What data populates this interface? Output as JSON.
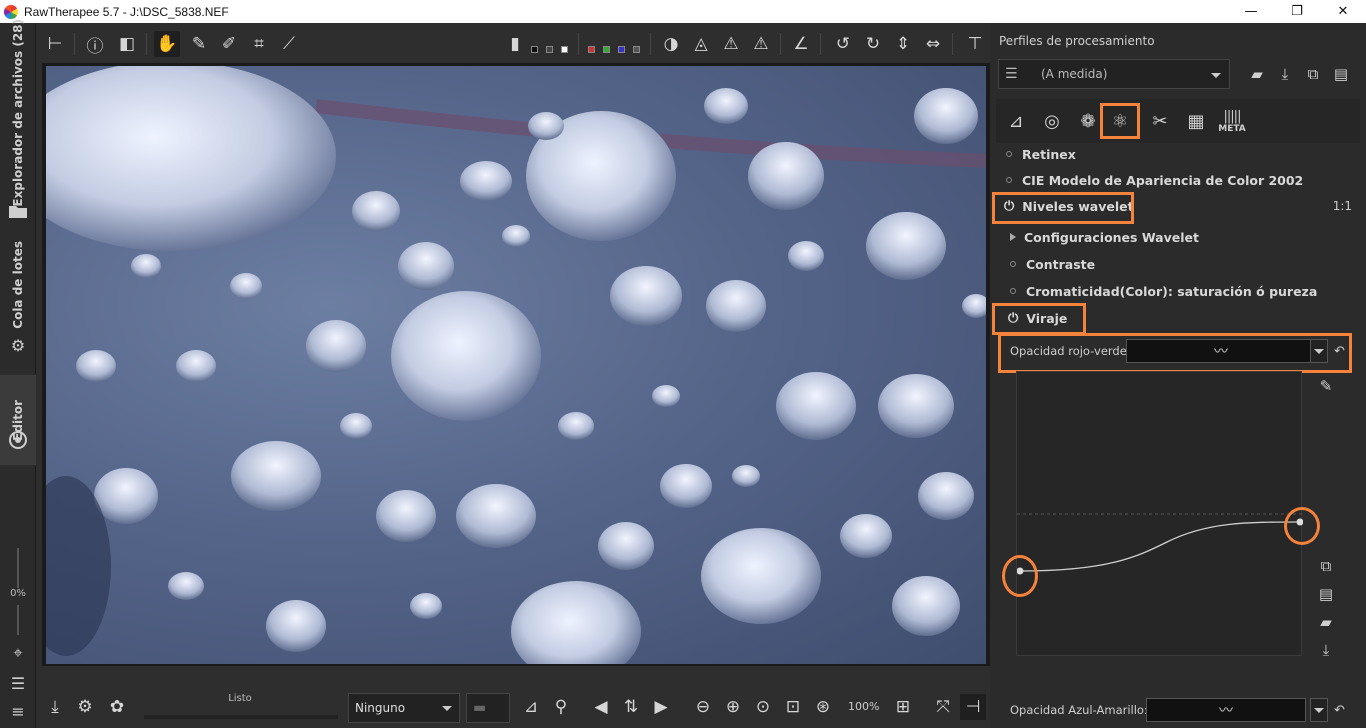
{
  "window": {
    "title": "RawTherapee 5.7 - J:\\DSC_5838.NEF",
    "controls": {
      "minimize": "—",
      "maximize": "❐",
      "close": "✕"
    }
  },
  "left_tabs": {
    "file_browser": "Explorador de archivos (28)",
    "batch_queue": "Cola de lotes",
    "editor": "Editor",
    "zoom_pct": "0%"
  },
  "bottom": {
    "status": "Listo",
    "filter_combo": "Ninguno",
    "zoom": "100%"
  },
  "right_panel": {
    "title": "Perfiles de procesamiento",
    "profile_value": "(A medida)",
    "tool_tabs": [
      "exposure-tab",
      "detail-tab",
      "color-tab",
      "advanced-tab",
      "transform-tab",
      "raw-tab",
      "metadata-tab"
    ],
    "meta_label": "META",
    "items": {
      "retinex": "Retinex",
      "ciecam": "CIE Modelo de Apariencia de Color 2002",
      "wavelet": "Niveles wavelet",
      "ratio": "1:1",
      "wavelet_settings": "Configuraciones Wavelet",
      "contrast": "Contraste",
      "chroma": "Cromaticidad(Color): saturación ó pureza",
      "toning": "Viraje"
    },
    "params": {
      "red_green": "Opacidad rojo-verde:",
      "blue_yellow": "Opacidad Azul-Amarillo:"
    },
    "accent": "#f5833b"
  }
}
